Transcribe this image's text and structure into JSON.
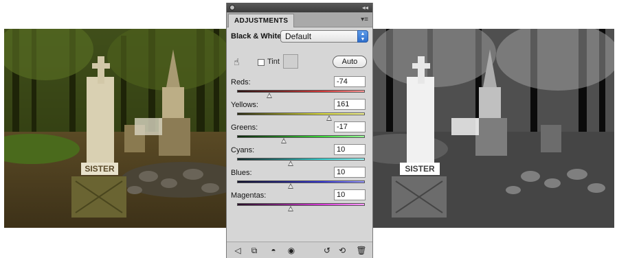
{
  "panel": {
    "tab_title": "ADJUSTMENTS",
    "adjustment_name": "Black & White",
    "preset_value": "Default",
    "tint_label": "Tint",
    "tint_checked": false,
    "auto_label": "Auto",
    "sliders": [
      {
        "label": "Reds:",
        "value": "-74",
        "numeric": -74,
        "track": "linear-gradient(to right,#2a1010,#7a2525,#d93a3a,#ff9a9a)"
      },
      {
        "label": "Yellows:",
        "value": "161",
        "numeric": 161,
        "track": "linear-gradient(to right,#2a2a10,#8a8a22,#e8e840,#ffff9a)"
      },
      {
        "label": "Greens:",
        "value": "-17",
        "numeric": -17,
        "track": "linear-gradient(to right,#102a10,#227a22,#3ad93a,#9aff9a)"
      },
      {
        "label": "Cyans:",
        "value": "10",
        "numeric": 10,
        "track": "linear-gradient(to right,#102a2a,#227a7a,#3ad9d9,#9affff)"
      },
      {
        "label": "Blues:",
        "value": "10",
        "numeric": 10,
        "track": "linear-gradient(to right,#10102a,#22227a,#3a3ad9,#9a9aff)"
      },
      {
        "label": "Magentas:",
        "value": "10",
        "numeric": 10,
        "track": "linear-gradient(to right,#2a102a,#7a227a,#d93ad9,#ff9aff)"
      }
    ],
    "bottom_icons": [
      "back-arrow-icon",
      "clip-to-layer-icon",
      "layer-visibility-circle-icon",
      "eye-icon",
      "view-previous-state-icon",
      "reset-icon",
      "trash-icon"
    ]
  },
  "photos": {
    "left_label": "SISTER",
    "right_label": "SISTER"
  }
}
